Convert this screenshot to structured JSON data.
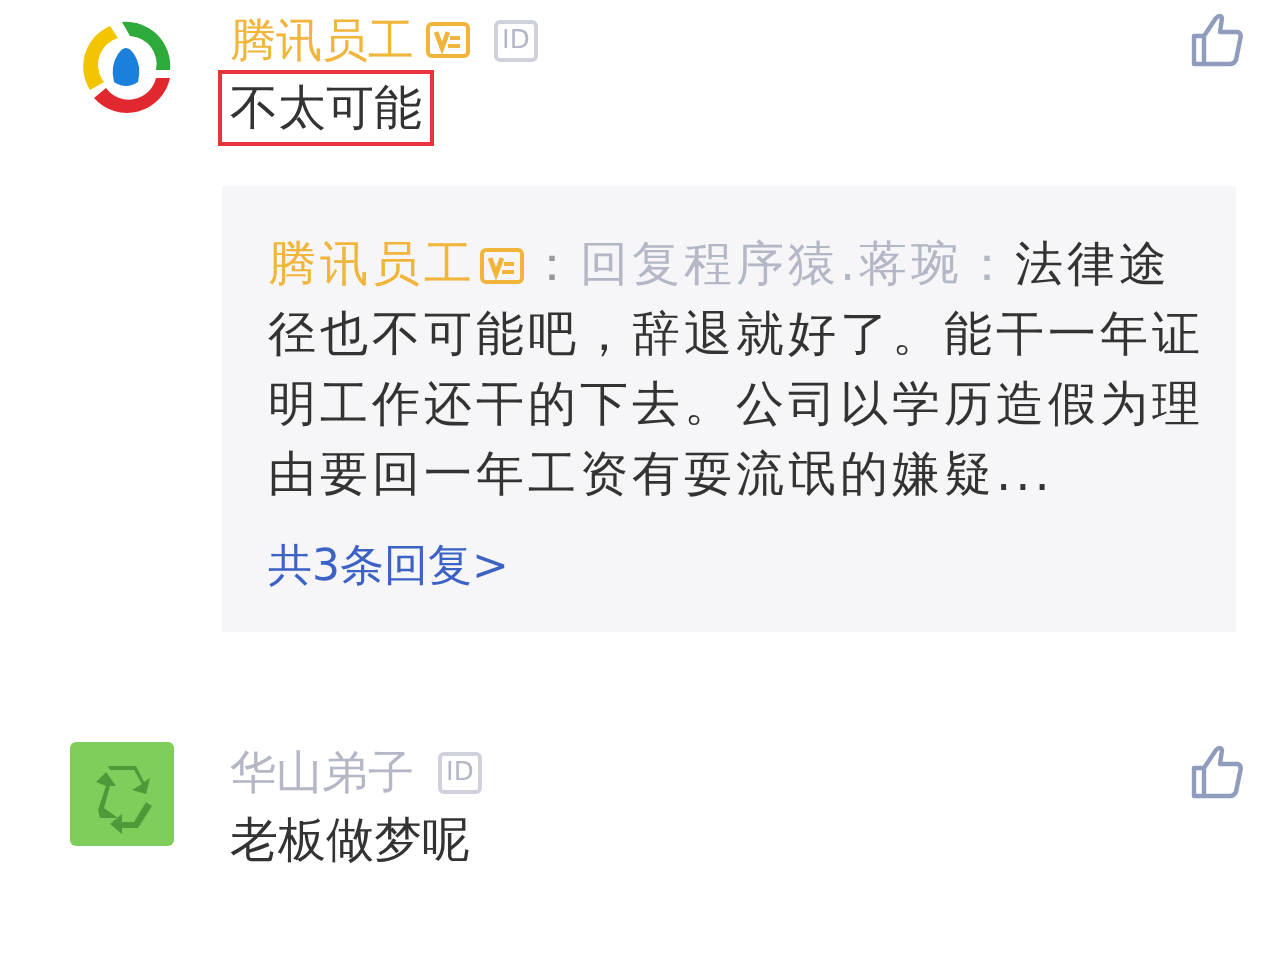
{
  "comments": [
    {
      "kind": "circle-logo",
      "author": "腾讯员工",
      "vip": true,
      "id_badge": "ID",
      "text": "不太可能",
      "highlighted": true,
      "replies": {
        "author": "腾讯员工",
        "vip": true,
        "separator": "：",
        "reply_to": "回复程序猿.蒋琬：",
        "text": "法律途径也不可能吧，辞退就好了。能干一年证明工作还干的下去。公司以学历造假为理由要回一年工资有耍流氓的嫌疑...",
        "more_link": "共3条回复>"
      }
    },
    {
      "kind": "recycle",
      "author": "华山弟子",
      "vip": false,
      "id_badge": "ID",
      "text": "老板做梦呢",
      "highlighted": false
    }
  ]
}
